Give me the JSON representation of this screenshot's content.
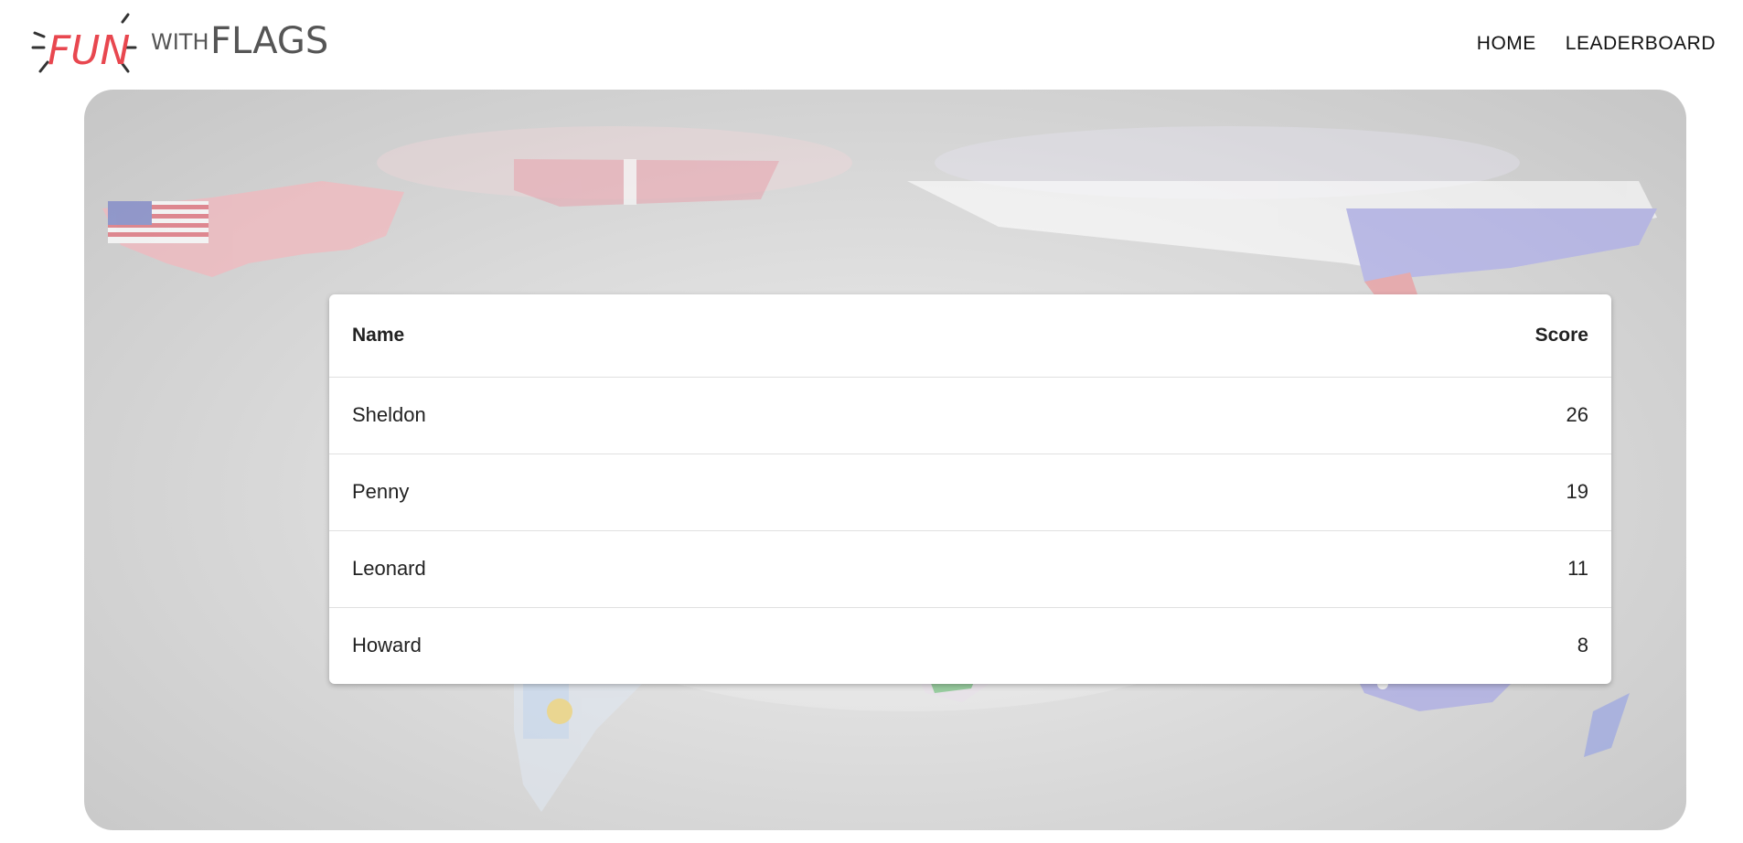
{
  "header": {
    "logo": {
      "text_a": "FUN",
      "text_b": "WITH",
      "text_c": "FLAGS"
    },
    "nav": [
      {
        "label": "HOME"
      },
      {
        "label": "LEADERBOARD"
      }
    ]
  },
  "leaderboard": {
    "columns": {
      "name": "Name",
      "score": "Score"
    },
    "rows": [
      {
        "name": "Sheldon",
        "score": "26"
      },
      {
        "name": "Penny",
        "score": "19"
      },
      {
        "name": "Leonard",
        "score": "11"
      },
      {
        "name": "Howard",
        "score": "8"
      }
    ]
  },
  "colors": {
    "logo_accent": "#e8474f",
    "logo_text": "#555555",
    "background": "#d9d9d9"
  }
}
